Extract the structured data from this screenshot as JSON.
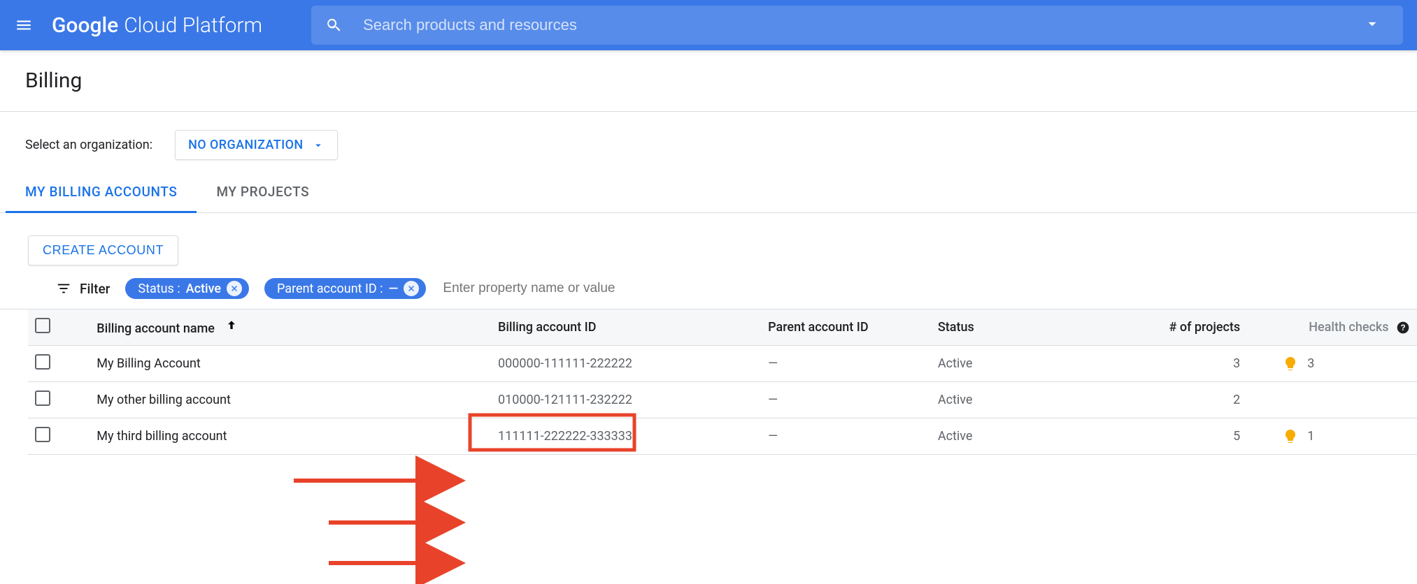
{
  "header": {
    "brand_google": "Google",
    "brand_cp": "Cloud Platform",
    "search_placeholder": "Search products and resources"
  },
  "page": {
    "title": "Billing",
    "org_label": "Select an organization:",
    "org_value": "NO ORGANIZATION"
  },
  "tabs": {
    "billing": "MY BILLING ACCOUNTS",
    "projects": "MY PROJECTS"
  },
  "toolbar": {
    "create_label": "CREATE ACCOUNT"
  },
  "filter": {
    "label": "Filter",
    "chips": [
      {
        "key": "Status : ",
        "val": "Active"
      },
      {
        "key": "Parent account ID : ",
        "val": "—"
      }
    ],
    "placeholder": "Enter property name or value"
  },
  "columns": {
    "name": "Billing account name",
    "id": "Billing account ID",
    "parent": "Parent account ID",
    "status": "Status",
    "projects": "# of projects",
    "health": "Health checks"
  },
  "rows": [
    {
      "name": "My Billing Account",
      "id": "000000-111111-222222",
      "parent": "—",
      "status": "Active",
      "projects": "3",
      "health_count": "3",
      "has_health": true
    },
    {
      "name": "My other billing account",
      "id": "010000-121111-232222",
      "parent": "—",
      "status": "Active",
      "projects": "2",
      "health_count": "",
      "has_health": false
    },
    {
      "name": "My third billing account",
      "id": "111111-222222-333333",
      "parent": "—",
      "status": "Active",
      "projects": "5",
      "health_count": "1",
      "has_health": true
    }
  ]
}
